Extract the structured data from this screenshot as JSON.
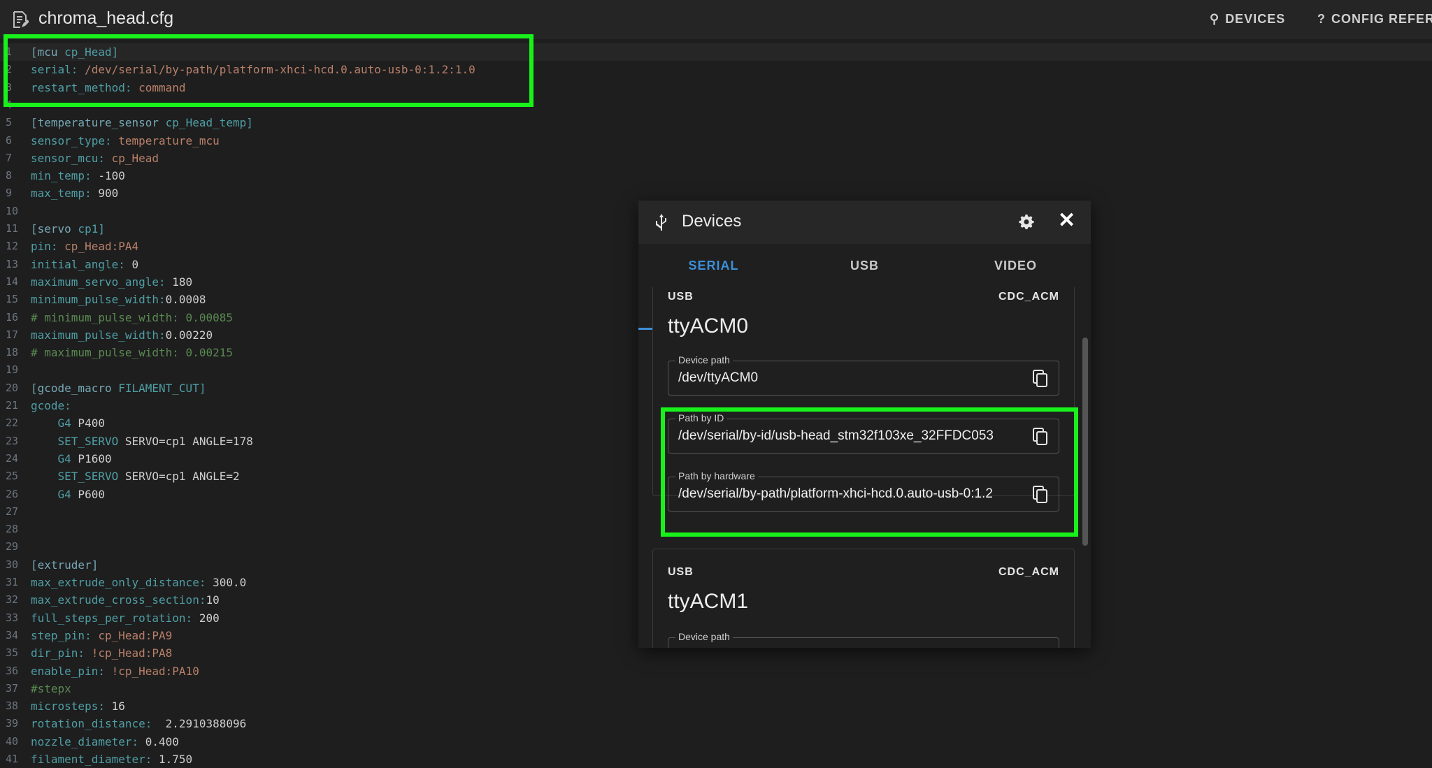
{
  "header": {
    "file_name": "chroma_head.cfg",
    "devices_label": "DEVICES",
    "config_ref_label": "CONFIG REFER"
  },
  "editor": {
    "lines": [
      {
        "n": "1",
        "code": "[mcu cp_Head]"
      },
      {
        "n": "2",
        "code": "serial: /dev/serial/by-path/platform-xhci-hcd.0.auto-usb-0:1.2:1.0"
      },
      {
        "n": "3",
        "code": "restart_method: command"
      },
      {
        "n": "4",
        "code": ""
      },
      {
        "n": "5",
        "code": "[temperature_sensor cp_Head_temp]"
      },
      {
        "n": "6",
        "code": "sensor_type: temperature_mcu"
      },
      {
        "n": "7",
        "code": "sensor_mcu: cp_Head"
      },
      {
        "n": "8",
        "code": "min_temp: -100"
      },
      {
        "n": "9",
        "code": "max_temp: 900"
      },
      {
        "n": "10",
        "code": ""
      },
      {
        "n": "11",
        "code": "[servo cp1]"
      },
      {
        "n": "12",
        "code": "pin: cp_Head:PA4"
      },
      {
        "n": "13",
        "code": "initial_angle: 0"
      },
      {
        "n": "14",
        "code": "maximum_servo_angle: 180"
      },
      {
        "n": "15",
        "code": "minimum_pulse_width:0.0008"
      },
      {
        "n": "16",
        "code": "# minimum_pulse_width: 0.00085"
      },
      {
        "n": "17",
        "code": "maximum_pulse_width:0.00220"
      },
      {
        "n": "18",
        "code": "# maximum_pulse_width: 0.00215"
      },
      {
        "n": "19",
        "code": ""
      },
      {
        "n": "20",
        "code": "[gcode_macro FILAMENT_CUT]"
      },
      {
        "n": "21",
        "code": "gcode:"
      },
      {
        "n": "22",
        "code": "    G4 P400"
      },
      {
        "n": "23",
        "code": "    SET_SERVO SERVO=cp1 ANGLE=178"
      },
      {
        "n": "24",
        "code": "    G4 P1600"
      },
      {
        "n": "25",
        "code": "    SET_SERVO SERVO=cp1 ANGLE=2"
      },
      {
        "n": "26",
        "code": "    G4 P600"
      },
      {
        "n": "27",
        "code": ""
      },
      {
        "n": "28",
        "code": ""
      },
      {
        "n": "29",
        "code": ""
      },
      {
        "n": "30",
        "code": "[extruder]"
      },
      {
        "n": "31",
        "code": "max_extrude_only_distance: 300.0"
      },
      {
        "n": "32",
        "code": "max_extrude_cross_section:10"
      },
      {
        "n": "33",
        "code": "full_steps_per_rotation: 200"
      },
      {
        "n": "34",
        "code": "step_pin: cp_Head:PA9"
      },
      {
        "n": "35",
        "code": "dir_pin: !cp_Head:PA8"
      },
      {
        "n": "36",
        "code": "enable_pin: !cp_Head:PA10"
      },
      {
        "n": "37",
        "code": "#stepx"
      },
      {
        "n": "38",
        "code": "microsteps: 16"
      },
      {
        "n": "39",
        "code": "rotation_distance:  2.2910388096"
      },
      {
        "n": "40",
        "code": "nozzle_diameter: 0.400"
      },
      {
        "n": "41",
        "code": "filament_diameter: 1.750"
      }
    ]
  },
  "devices_panel": {
    "title": "Devices",
    "tabs": [
      "SERIAL",
      "USB",
      "VIDEO"
    ],
    "active_tab": "SERIAL",
    "devices": [
      {
        "type": "USB",
        "driver": "CDC_ACM",
        "name": "ttyACM0",
        "fields": [
          {
            "label": "Device path",
            "value": "/dev/ttyACM0"
          },
          {
            "label": "Path by ID",
            "value": "/dev/serial/by-id/usb-head_stm32f103xe_32FFDC053"
          },
          {
            "label": "Path by hardware",
            "value": "/dev/serial/by-path/platform-xhci-hcd.0.auto-usb-0:1.2"
          }
        ]
      },
      {
        "type": "USB",
        "driver": "CDC_ACM",
        "name": "ttyACM1",
        "fields": [
          {
            "label": "Device path",
            "value": ""
          }
        ]
      }
    ]
  },
  "colors": {
    "highlight": "#18f21a",
    "accent": "#3d8fd8",
    "background": "#1e1e1e"
  }
}
